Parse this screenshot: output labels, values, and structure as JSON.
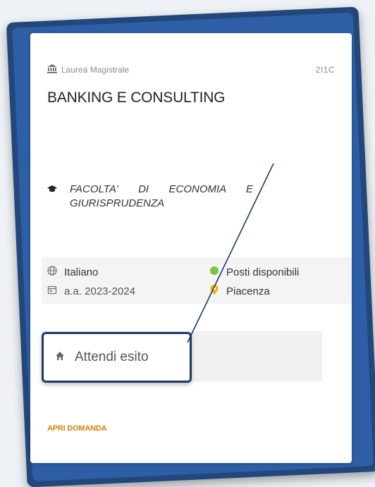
{
  "card": {
    "degree_type": "Laurea Magistrale",
    "code": "2I1C",
    "title": "BANKING E CONSULTING",
    "faculty": "FACOLTA' DI ECONOMIA E GIURISPRUDENZA",
    "language": "Italiano",
    "academic_year": "a.a. 2023-2024",
    "availability": "Posti disponibili",
    "location": "Piacenza",
    "status": "Attendi esito",
    "action": "APRI DOMANDA"
  },
  "colors": {
    "frame": "#2d5ea6",
    "availability_dot": "#7dc242",
    "location_pin": "#f0b31a",
    "action": "#d4820c",
    "highlight_border": "#1c3a66"
  },
  "icons": {
    "degree": "institution-icon",
    "faculty": "graduation-cap-icon",
    "language": "globe-icon",
    "year": "calendar-icon",
    "availability": "green-dot-icon",
    "location": "map-pin-icon",
    "status": "home-icon"
  }
}
